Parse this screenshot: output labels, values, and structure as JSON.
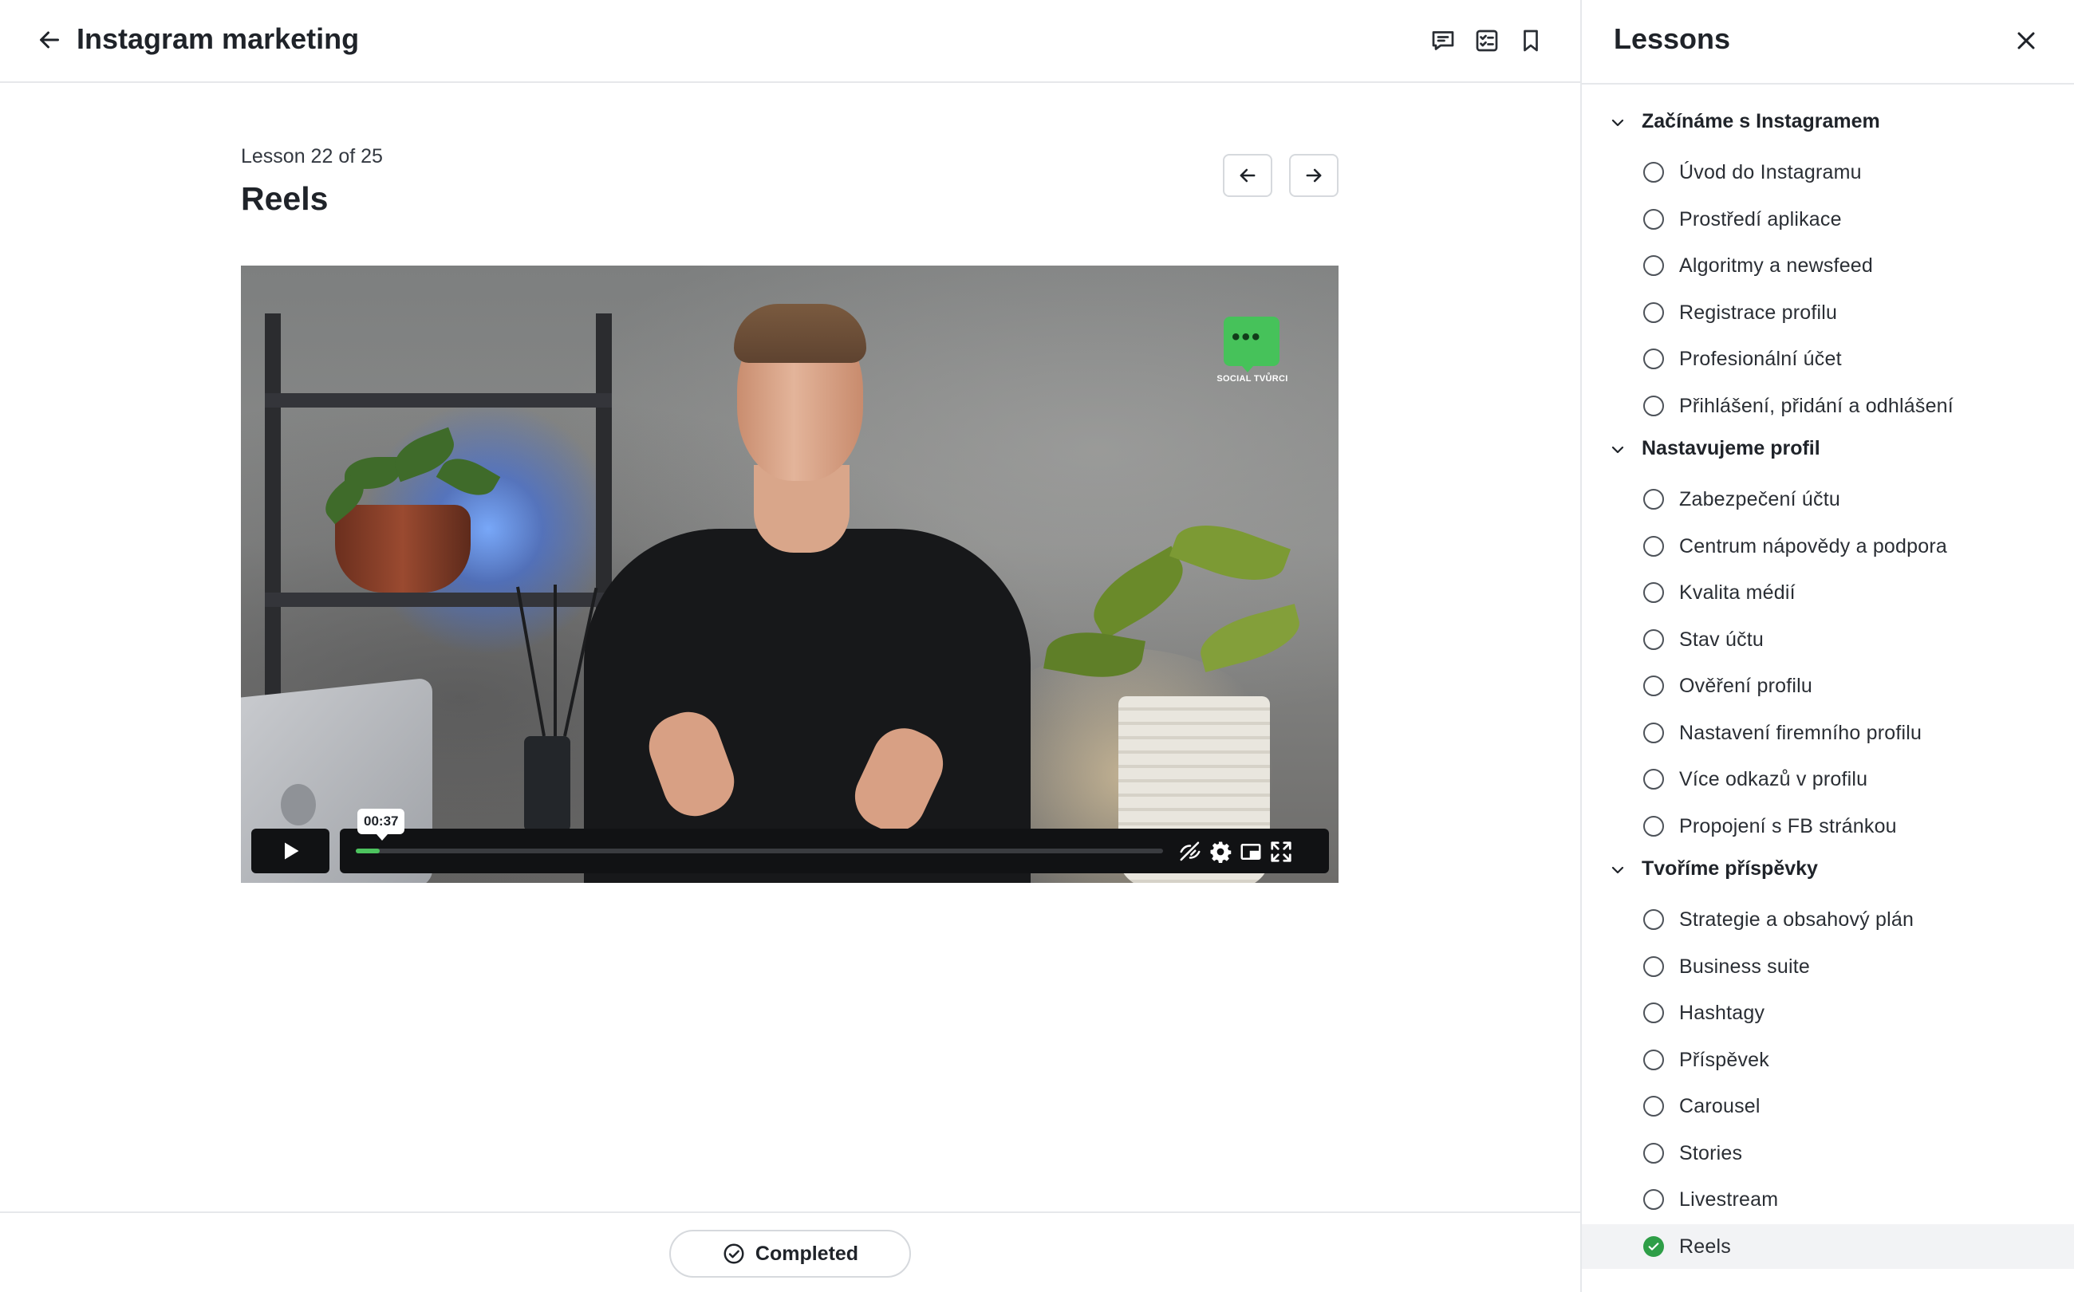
{
  "header": {
    "back_icon": "arrow-left-icon",
    "course_title": "Instagram marketing",
    "actions": [
      {
        "name": "comments-button",
        "icon": "chat-icon"
      },
      {
        "name": "notes-button",
        "icon": "checklist-icon"
      },
      {
        "name": "bookmark-button",
        "icon": "bookmark-icon"
      }
    ]
  },
  "lesson": {
    "counter": "Lesson 22 of 25",
    "title": "Reels",
    "prev_icon": "arrow-left-icon",
    "next_icon": "arrow-right-icon"
  },
  "video": {
    "brand_text": "SOCIAL TVŮRCI",
    "current_time": "00:37",
    "progress": 0.03,
    "accent_color": "#4dc35f",
    "controls": [
      "play-icon",
      "captions-off-icon",
      "settings-icon",
      "picture-in-picture-icon",
      "fullscreen-icon"
    ]
  },
  "footer": {
    "completed_label": "Completed",
    "completed_icon": "check-circle-icon"
  },
  "sidebar": {
    "title": "Lessons",
    "close_icon": "close-icon",
    "completed_color": "#2e9e47",
    "sections": [
      {
        "title": "Začínáme s Instagramem",
        "lessons": [
          {
            "label": "Úvod do Instagramu",
            "completed": false
          },
          {
            "label": "Prostředí aplikace",
            "completed": false
          },
          {
            "label": "Algoritmy a newsfeed",
            "completed": false
          },
          {
            "label": "Registrace profilu",
            "completed": false
          },
          {
            "label": "Profesionální účet",
            "completed": false
          },
          {
            "label": "Přihlášení, přidání a odhlášení",
            "completed": false
          }
        ]
      },
      {
        "title": "Nastavujeme profil",
        "lessons": [
          {
            "label": "Zabezpečení účtu",
            "completed": false
          },
          {
            "label": "Centrum nápovědy a podpora",
            "completed": false
          },
          {
            "label": "Kvalita médií",
            "completed": false
          },
          {
            "label": "Stav účtu",
            "completed": false
          },
          {
            "label": "Ověření profilu",
            "completed": false
          },
          {
            "label": "Nastavení firemního profilu",
            "completed": false
          },
          {
            "label": "Více odkazů v profilu",
            "completed": false
          },
          {
            "label": "Propojení s FB stránkou",
            "completed": false
          }
        ]
      },
      {
        "title": "Tvoříme příspěvky",
        "lessons": [
          {
            "label": "Strategie a obsahový plán",
            "completed": false
          },
          {
            "label": "Business suite",
            "completed": false
          },
          {
            "label": "Hashtagy",
            "completed": false
          },
          {
            "label": "Příspěvek",
            "completed": false
          },
          {
            "label": "Carousel",
            "completed": false
          },
          {
            "label": "Stories",
            "completed": false
          },
          {
            "label": "Livestream",
            "completed": false
          },
          {
            "label": "Reels",
            "completed": true,
            "active": true
          }
        ]
      }
    ]
  }
}
